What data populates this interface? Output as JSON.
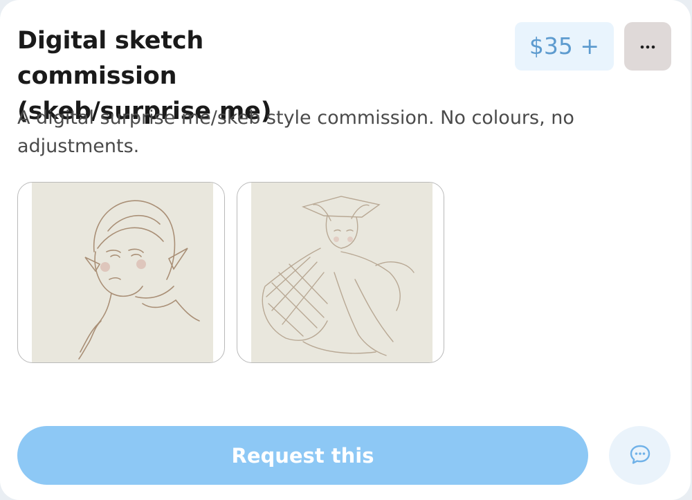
{
  "listing": {
    "title": "Digital sketch commission (skeb/surprise me)",
    "price": "$35 +",
    "description": "A digital surprise me/skeb style commission. No colours, no adjustments.",
    "request_label": "Request this"
  },
  "icons": {
    "more": "more-horizontal-icon",
    "chat": "chat-bubble-icon"
  },
  "colors": {
    "price_text": "#5d9bcf",
    "price_bg": "#e9f4fd",
    "request_bg": "#8dc8f5",
    "chat_bg": "#eaf3fb",
    "more_bg": "#dfd9d8"
  }
}
